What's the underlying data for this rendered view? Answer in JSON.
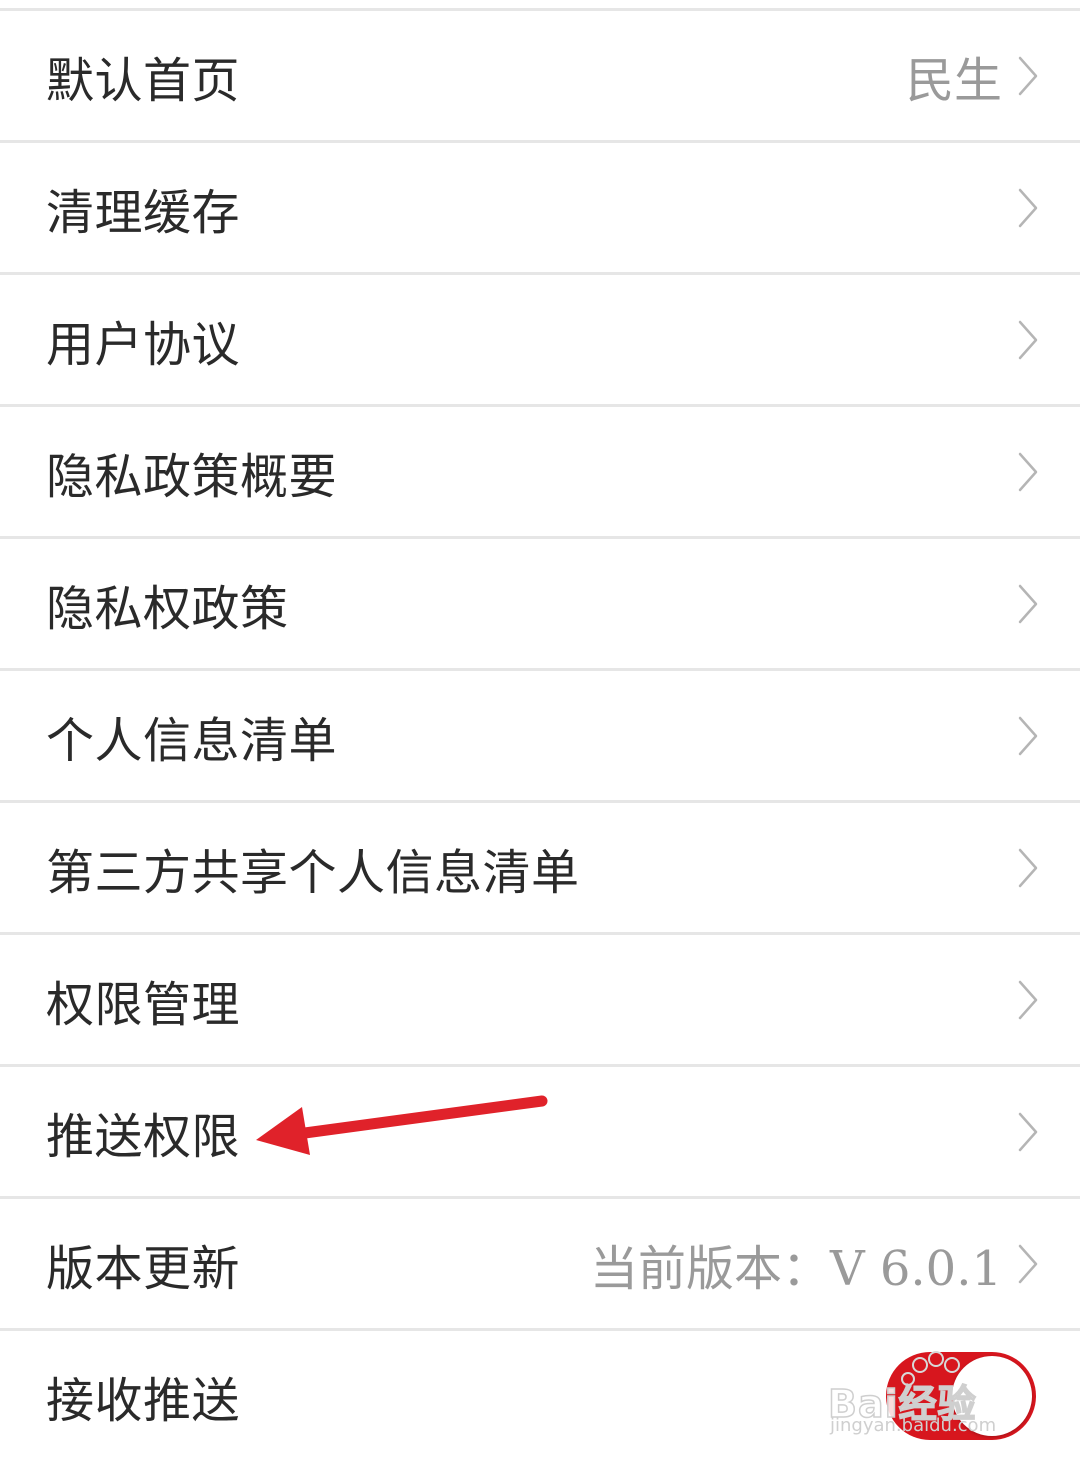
{
  "settings": {
    "items": [
      {
        "label": "默认首页",
        "value": "民生"
      },
      {
        "label": "清理缓存",
        "value": ""
      },
      {
        "label": "用户协议",
        "value": ""
      },
      {
        "label": "隐私政策概要",
        "value": ""
      },
      {
        "label": "隐私权政策",
        "value": ""
      },
      {
        "label": "个人信息清单",
        "value": ""
      },
      {
        "label": "第三方共享个人信息清单",
        "value": ""
      },
      {
        "label": "权限管理",
        "value": ""
      },
      {
        "label": "推送权限",
        "value": ""
      },
      {
        "label": "版本更新",
        "value": "当前版本：V 6.0.1"
      }
    ],
    "toggle_row": {
      "label": "接收推送",
      "on": true
    }
  },
  "colors": {
    "toggle_on": "#d7161e",
    "arrow": "#e0222a",
    "divider": "#e6e6e6",
    "label_text": "#2a2a2a",
    "value_text": "#9a9a9a"
  },
  "icons": {
    "chevron": "chevron-right-icon",
    "annotation": "red-arrow-icon",
    "watermark": "baidu-jingyan-watermark"
  },
  "watermark": {
    "brand": "Bai经验",
    "url": "jingyan.baidu.com"
  }
}
